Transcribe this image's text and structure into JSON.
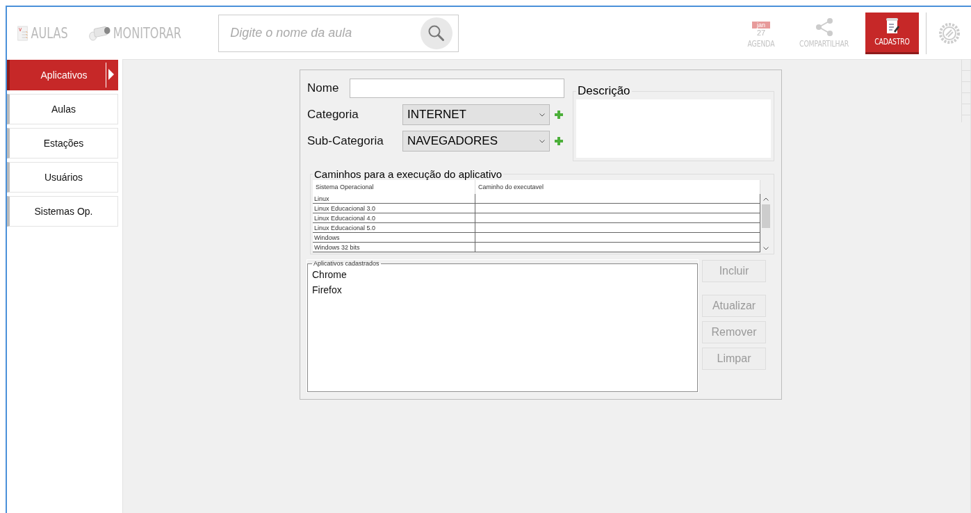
{
  "top_nav": {
    "left_items": [
      {
        "label": "AULAS",
        "kind": "lessons",
        "selected": false
      },
      {
        "label": "MONITORAR",
        "kind": "camera",
        "selected": false
      }
    ],
    "search": {
      "placeholder": "Digite o nome da aula"
    },
    "right_items": [
      {
        "label": "AGENDA",
        "kind": "calendar",
        "month": "jan",
        "day": "27",
        "selected": false
      },
      {
        "label": "COMPARTILHAR",
        "kind": "share",
        "selected": false
      },
      {
        "label": "CADASTRO",
        "kind": "register",
        "selected": true
      }
    ]
  },
  "sidebar": {
    "items": [
      {
        "label": "Aplicativos",
        "selected": true
      },
      {
        "label": "Aulas",
        "selected": false
      },
      {
        "label": "Estações",
        "selected": false
      },
      {
        "label": "Usuários",
        "selected": false
      },
      {
        "label": "Sistemas Op.",
        "selected": false
      }
    ]
  },
  "form": {
    "name_label": "Nome",
    "category_label": "Categoria",
    "category_value": "INTERNET",
    "subcategory_label": "Sub-Categoria",
    "subcategory_value": "NAVEGADORES",
    "description_label": "Descrição",
    "paths": {
      "title": "Caminhos para a execução do aplicativo",
      "columns": [
        "Sistema Operacional",
        "Caminho do executavel"
      ],
      "rows": [
        [
          "Linux",
          ""
        ],
        [
          "Linux Educacional 3.0",
          ""
        ],
        [
          "Linux Educacional 4.0",
          ""
        ],
        [
          "Linux Educacional 5.0",
          ""
        ],
        [
          "Windows",
          ""
        ],
        [
          "Windows 32 bits",
          ""
        ]
      ]
    },
    "registered": {
      "title": "Aplicativos cadastrados",
      "items": [
        "Chrome",
        "Firefox"
      ]
    },
    "buttons": [
      {
        "label": "Incluir",
        "disabled": true
      },
      {
        "label": "Atualizar",
        "disabled": true
      },
      {
        "label": "Remover",
        "disabled": true
      },
      {
        "label": "Limpar",
        "disabled": true
      }
    ]
  }
}
